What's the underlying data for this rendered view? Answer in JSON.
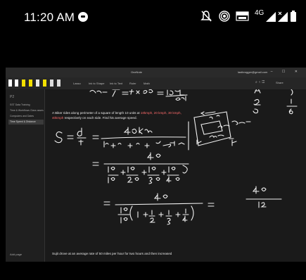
{
  "status_bar": {
    "time": "11:20 AM",
    "network": "4G"
  },
  "window": {
    "title": "OneNote",
    "user": "lastbrogger@gmail.com"
  },
  "toolbar": {
    "items": [
      "Lasso",
      "Ink to Shape",
      "Ink to Text",
      "Ruler",
      "Math"
    ],
    "share": "Share"
  },
  "sidebar": {
    "header": "P2",
    "pages": [
      "SST Data Training",
      "Time & Workflows Class assessment",
      "Computers and Dates",
      "Time Speed & Distance"
    ],
    "selected_index": 3,
    "add_page": "Add page"
  },
  "canvas": {
    "question_part1": "A Biker rides along perimeter of a square of length 10 units at ",
    "question_red1": "10kmph, 20 kmph,",
    "question_red2": "30 kmph, 40kmph",
    "question_part2": " respectively on each side. Find his average speed.",
    "footer": "Sujit drove at an average rate of 50 miles per hour for two hours and then increased"
  }
}
